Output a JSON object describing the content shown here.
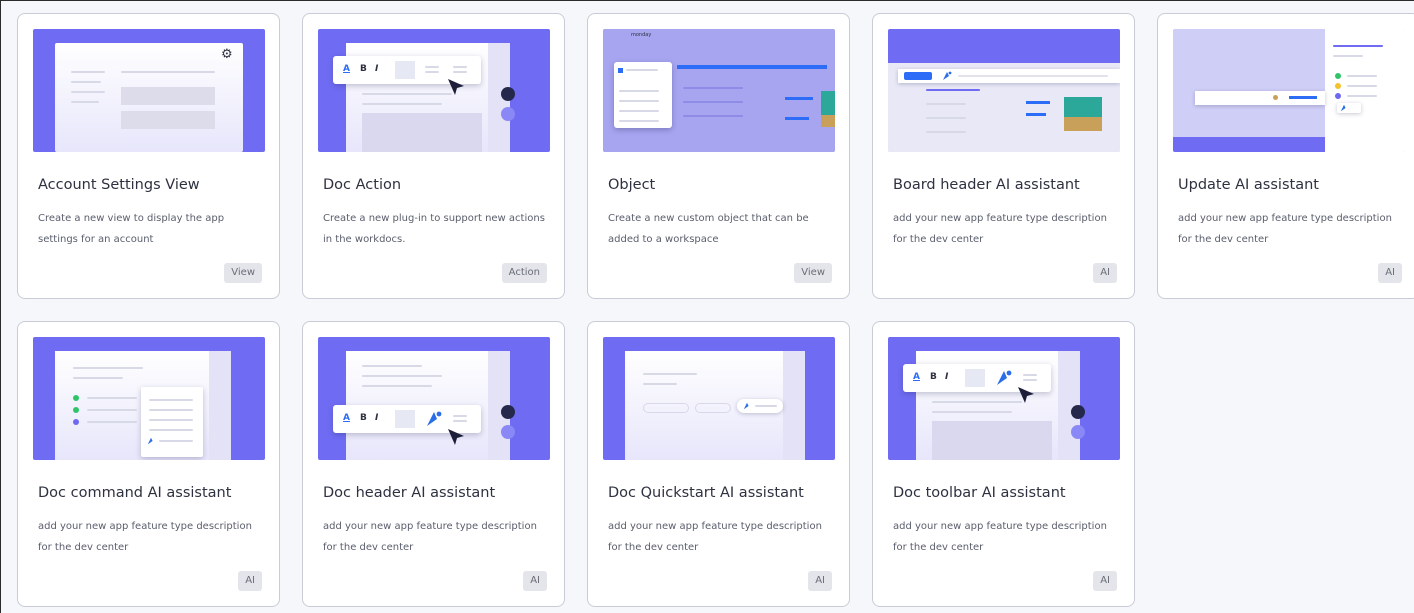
{
  "cards": [
    {
      "title": "Account Settings View",
      "desc": "Create a new view to display the app settings for an account",
      "tag": "View",
      "thumb_icon": "gear-icon"
    },
    {
      "title": "Doc Action",
      "desc": "Create a new plug-in to support new actions in the workdocs.",
      "tag": "Action",
      "thumb_icon": "cursor-icon"
    },
    {
      "title": "Object",
      "desc": "Create a new custom object that can be added to a workspace",
      "tag": "View",
      "thumb_icon": "board-icon"
    },
    {
      "title": "Board header AI assistant",
      "desc": "add your new app feature type description for the dev center",
      "tag": "AI",
      "thumb_icon": "ai-icon"
    },
    {
      "title": "Update AI assistant",
      "desc": "add your new app feature type description for the dev center",
      "tag": "AI",
      "thumb_icon": "ai-icon"
    },
    {
      "title": "Doc command AI assistant",
      "desc": "add your new app feature type description for the dev center",
      "tag": "AI",
      "thumb_icon": "ai-icon"
    },
    {
      "title": "Doc header AI assistant",
      "desc": "add your new app feature type description for the dev center",
      "tag": "AI",
      "thumb_icon": "ai-icon"
    },
    {
      "title": "Doc Quickstart AI assistant",
      "desc": "add your new app feature type description for the dev center",
      "tag": "AI",
      "thumb_icon": "ai-icon"
    },
    {
      "title": "Doc toolbar AI assistant",
      "desc": "add your new app feature type description for the dev center",
      "tag": "AI",
      "thumb_icon": "ai-icon"
    }
  ],
  "thumb_text": {
    "toolbar_a": "A",
    "toolbar_b": "B",
    "toolbar_i": "I",
    "monday_brand": "monday",
    "gear_glyph": "⚙"
  },
  "colors": {
    "thumb_bg": "#6f6cf3",
    "accent_blue": "#2d6cf6",
    "ai_blue": "#2a6ee8",
    "teal": "#2ba89a",
    "amber": "#c8a05a",
    "green_dot": "#2fc46a",
    "purple_dot": "#6e68f0",
    "yellow_dot": "#f5c12c",
    "avatar_dark": "#25284a"
  }
}
